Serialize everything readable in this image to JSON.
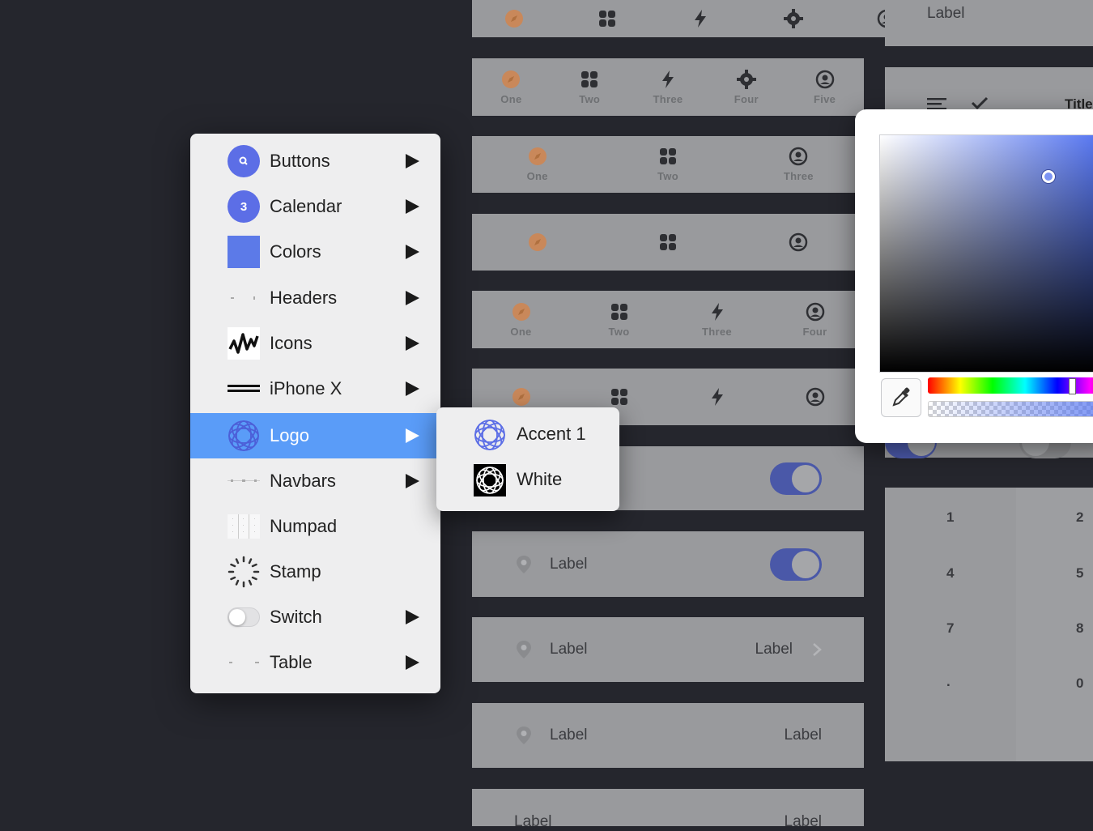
{
  "menu": {
    "items": [
      {
        "label": "Buttons",
        "icon": "search-badge-icon",
        "has_submenu": true
      },
      {
        "label": "Calendar",
        "icon": "number-badge-icon",
        "badge": "3",
        "has_submenu": true
      },
      {
        "label": "Colors",
        "icon": "color-swatch-icon",
        "has_submenu": true
      },
      {
        "label": "Headers",
        "icon": "headers-thumbnail-icon",
        "has_submenu": true
      },
      {
        "label": "Icons",
        "icon": "waveform-icon",
        "has_submenu": true
      },
      {
        "label": "iPhone X",
        "icon": "iphone-bar-icon",
        "has_submenu": true
      },
      {
        "label": "Logo",
        "icon": "logo-icon",
        "has_submenu": true,
        "highlighted": true
      },
      {
        "label": "Navbars",
        "icon": "navbars-thumbnail-icon",
        "has_submenu": true
      },
      {
        "label": "Numpad",
        "icon": "numpad-thumbnail-icon",
        "has_submenu": false
      },
      {
        "label": "Stamp",
        "icon": "spinner-icon",
        "has_submenu": false
      },
      {
        "label": "Switch",
        "icon": "switch-icon",
        "has_submenu": true
      },
      {
        "label": "Table",
        "icon": "table-thumbnail-icon",
        "has_submenu": true
      }
    ]
  },
  "submenu": {
    "items": [
      {
        "label": "Accent 1",
        "icon": "logo-accent-icon"
      },
      {
        "label": "White",
        "icon": "logo-white-icon"
      }
    ]
  },
  "tabbars": {
    "row2": [
      "One",
      "Two",
      "Three",
      "Four",
      "Five"
    ],
    "row3": [
      "One",
      "Two",
      "Three"
    ],
    "row5": [
      "One",
      "Two",
      "Three",
      "Four"
    ]
  },
  "rows": {
    "row8_label": "Label",
    "row9_label": "Label",
    "row9_value": "Label",
    "row10_label": "Label",
    "row10_value": "Label",
    "row11_label": "Label",
    "row11_value": "Label"
  },
  "right": {
    "top_label": "Label",
    "title_partial": "Title"
  },
  "numpad": {
    "keys": [
      "1",
      "2",
      "4",
      "5",
      "7",
      "8",
      ".",
      "0"
    ]
  },
  "colors": {
    "background": "#25262d",
    "accent": "#5a9cf8",
    "brand_blue": "#5c6ee6",
    "toggle_on": "#4a58a8",
    "tab_icon_orange": "#c9885a"
  }
}
